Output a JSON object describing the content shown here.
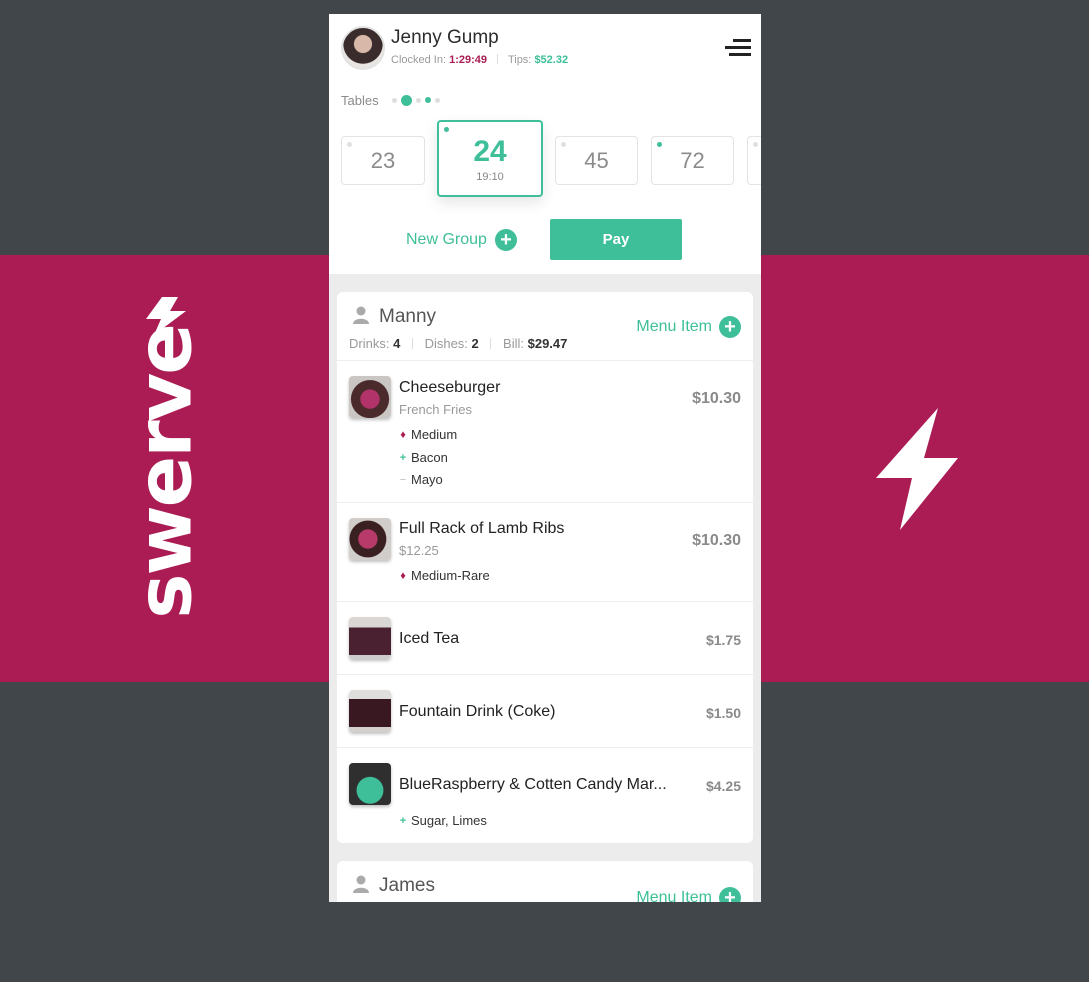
{
  "brand": {
    "word": "swerve"
  },
  "header": {
    "user_name": "Jenny Gump",
    "clocked_label": "Clocked In:",
    "clocked_value": "1:29:49",
    "tips_label": "Tips:",
    "tips_value": "$52.32"
  },
  "tables": {
    "label": "Tables",
    "cards": [
      {
        "number": "23"
      },
      {
        "number": "24",
        "time": "19:10"
      },
      {
        "number": "45"
      },
      {
        "number": "72"
      }
    ]
  },
  "actions": {
    "new_group": "New Group",
    "pay": "Pay"
  },
  "groups": [
    {
      "name": "Manny",
      "drinks_label": "Drinks:",
      "drinks": "4",
      "dishes_label": "Dishes:",
      "dishes": "2",
      "bill_label": "Bill:",
      "bill": "$29.47",
      "add_label": "Menu Item",
      "items": [
        {
          "name": "Cheeseburger",
          "sub": "French Fries",
          "price": "$10.30",
          "mods": [
            {
              "type": "temp",
              "text": "Medium"
            },
            {
              "type": "add",
              "text": "Bacon"
            },
            {
              "type": "remove",
              "text": "Mayo"
            }
          ]
        },
        {
          "name": "Full Rack of Lamb Ribs",
          "sub": "$12.25",
          "price": "$10.30",
          "mods": [
            {
              "type": "temp",
              "text": "Medium-Rare"
            }
          ]
        },
        {
          "name": "Iced Tea",
          "price": "$1.75"
        },
        {
          "name": "Fountain Drink (Coke)",
          "price": "$1.50"
        },
        {
          "name": "BlueRaspberry & Cotten Candy Mar...",
          "price": "$4.25",
          "mods": [
            {
              "type": "add",
              "text": "Sugar, Limes"
            }
          ]
        }
      ]
    },
    {
      "name": "James",
      "add_label": "Menu Item"
    }
  ],
  "colors": {
    "accent": "#3ebf99",
    "brand": "#ab1c54",
    "background": "#41464b"
  }
}
